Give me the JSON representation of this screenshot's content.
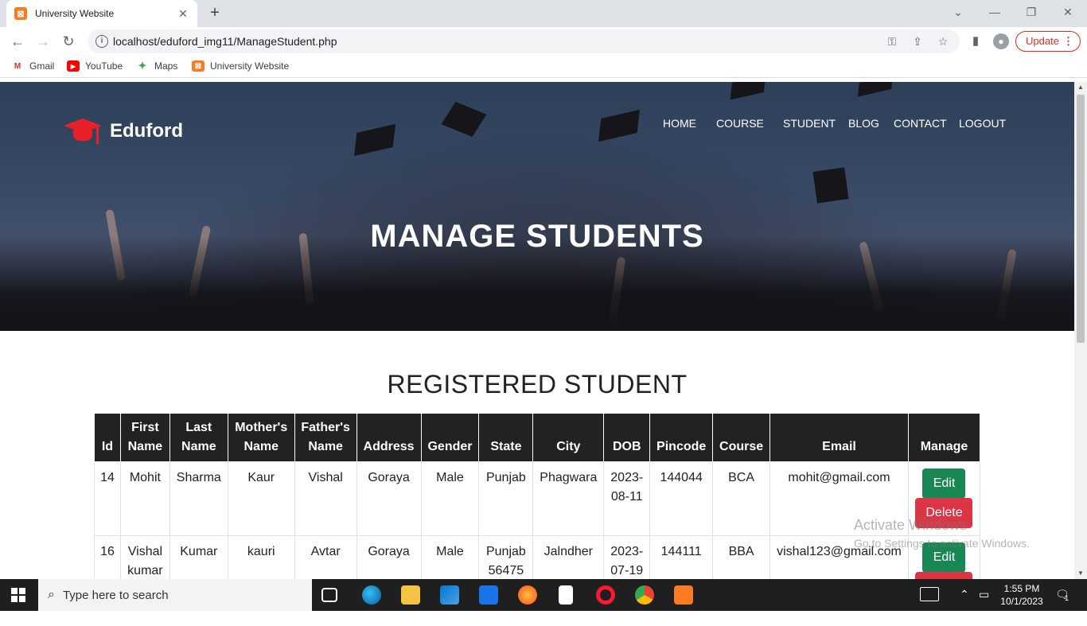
{
  "browser": {
    "tab_title": "University Website",
    "url": "localhost/eduford_img11/ManageStudent.php",
    "update_label": "Update",
    "bookmarks": [
      "Gmail",
      "YouTube",
      "Maps",
      "University Website"
    ]
  },
  "site": {
    "brand": "Eduford",
    "menu": [
      "HOME",
      "COURSE",
      "STUDENT",
      "BLOG",
      "CONTACT",
      "LOGOUT"
    ],
    "hero_title": "MANAGE STUDENTS",
    "section_title": "REGISTERED STUDENT"
  },
  "table": {
    "headers": [
      "Id",
      "First Name",
      "Last Name",
      "Mother's Name",
      "Father's Name",
      "Address",
      "Gender",
      "State",
      "City",
      "DOB",
      "Pincode",
      "Course",
      "Email",
      "Manage"
    ],
    "rows": [
      {
        "id": "14",
        "first": "Mohit",
        "last": "Sharma",
        "mother": "Kaur",
        "father": "Vishal",
        "address": "Goraya",
        "gender": "Male",
        "state": "Punjab",
        "city": "Phagwara",
        "dob": "2023-08-11",
        "pincode": "144044",
        "course": "BCA",
        "email": "mohit@gmail.com"
      },
      {
        "id": "16",
        "first": "Vishal kumar",
        "last": "Kumar",
        "mother": "kauri",
        "father": "Avtar",
        "address": "Goraya",
        "gender": "Male",
        "state": "Punjab 56475",
        "city": "Jalndher",
        "dob": "2023-07-19",
        "pincode": "144111",
        "course": "BBA",
        "email": "vishal123@gmail.com"
      }
    ],
    "edit_label": "Edit",
    "delete_label": "Delete"
  },
  "watermark": {
    "line1": "Activate Windows",
    "line2": "Go to Settings to activate Windows."
  },
  "taskbar": {
    "search_placeholder": "Type here to search",
    "time": "1:55 PM",
    "date": "10/1/2023",
    "notification_count": "1"
  },
  "colors": {
    "brand_red": "#e8202a",
    "edit_green": "#198754",
    "delete_red": "#dc3545",
    "table_header": "#222222"
  }
}
